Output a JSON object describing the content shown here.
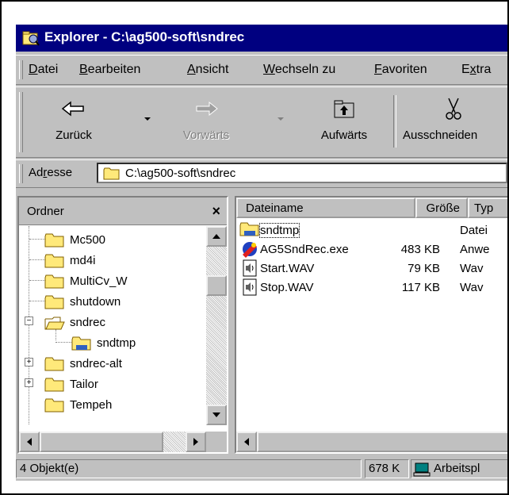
{
  "window": {
    "title": "Explorer - C:\\ag500-soft\\sndrec"
  },
  "menu": [
    {
      "label": "Datei",
      "u": "D",
      "rest": "atei"
    },
    {
      "label": "Bearbeiten",
      "u": "B",
      "rest": "earbeiten"
    },
    {
      "label": "Ansicht",
      "u": "A",
      "rest": "nsicht"
    },
    {
      "label": "Wechseln zu",
      "u": "W",
      "rest": "echseln zu"
    },
    {
      "label": "Favoriten",
      "u": "F",
      "rest": "avoriten"
    },
    {
      "label": "Extras",
      "pre": "E",
      "u": "x",
      "rest": "tra"
    }
  ],
  "toolbar": {
    "back": "Zurück",
    "forward": "Vorwärts",
    "up": "Aufwärts",
    "cut": "Ausschneiden"
  },
  "address": {
    "label_pre": "Ad",
    "label_u": "r",
    "label_post": "esse",
    "value": "C:\\ag500-soft\\sndrec"
  },
  "folders_pane": {
    "title": "Ordner",
    "close": "×",
    "items": [
      {
        "label": "Mc500"
      },
      {
        "label": "md4i"
      },
      {
        "label": "MultiCv_W"
      },
      {
        "label": "shutdown"
      },
      {
        "label": "sndrec",
        "expanded": true,
        "open": true
      },
      {
        "label": "sndtmp",
        "child": true
      },
      {
        "label": "sndrec-alt",
        "expander": "+"
      },
      {
        "label": "Tailor",
        "expander": "+"
      },
      {
        "label": "Tempeh"
      }
    ]
  },
  "files": {
    "columns": {
      "name": "Dateiname",
      "size": "Größe",
      "type": "Typ"
    },
    "rows": [
      {
        "name": "sndtmp",
        "size": "",
        "type": "Datei",
        "icon": "folder-icon"
      },
      {
        "name": "AG5SndRec.exe",
        "size": "483 KB",
        "type": "Anwe",
        "icon": "exe-icon"
      },
      {
        "name": "Start.WAV",
        "size": "79 KB",
        "type": "Wav",
        "icon": "wav-icon"
      },
      {
        "name": "Stop.WAV",
        "size": "117 KB",
        "type": "Wav",
        "icon": "wav-icon"
      }
    ]
  },
  "status": {
    "count": "4 Objekt(e)",
    "size": "678 K",
    "location": "Arbeitspl"
  },
  "colors": {
    "title_bar": "#000080",
    "face": "#c0c0c0",
    "folder": "#ffe97a"
  }
}
